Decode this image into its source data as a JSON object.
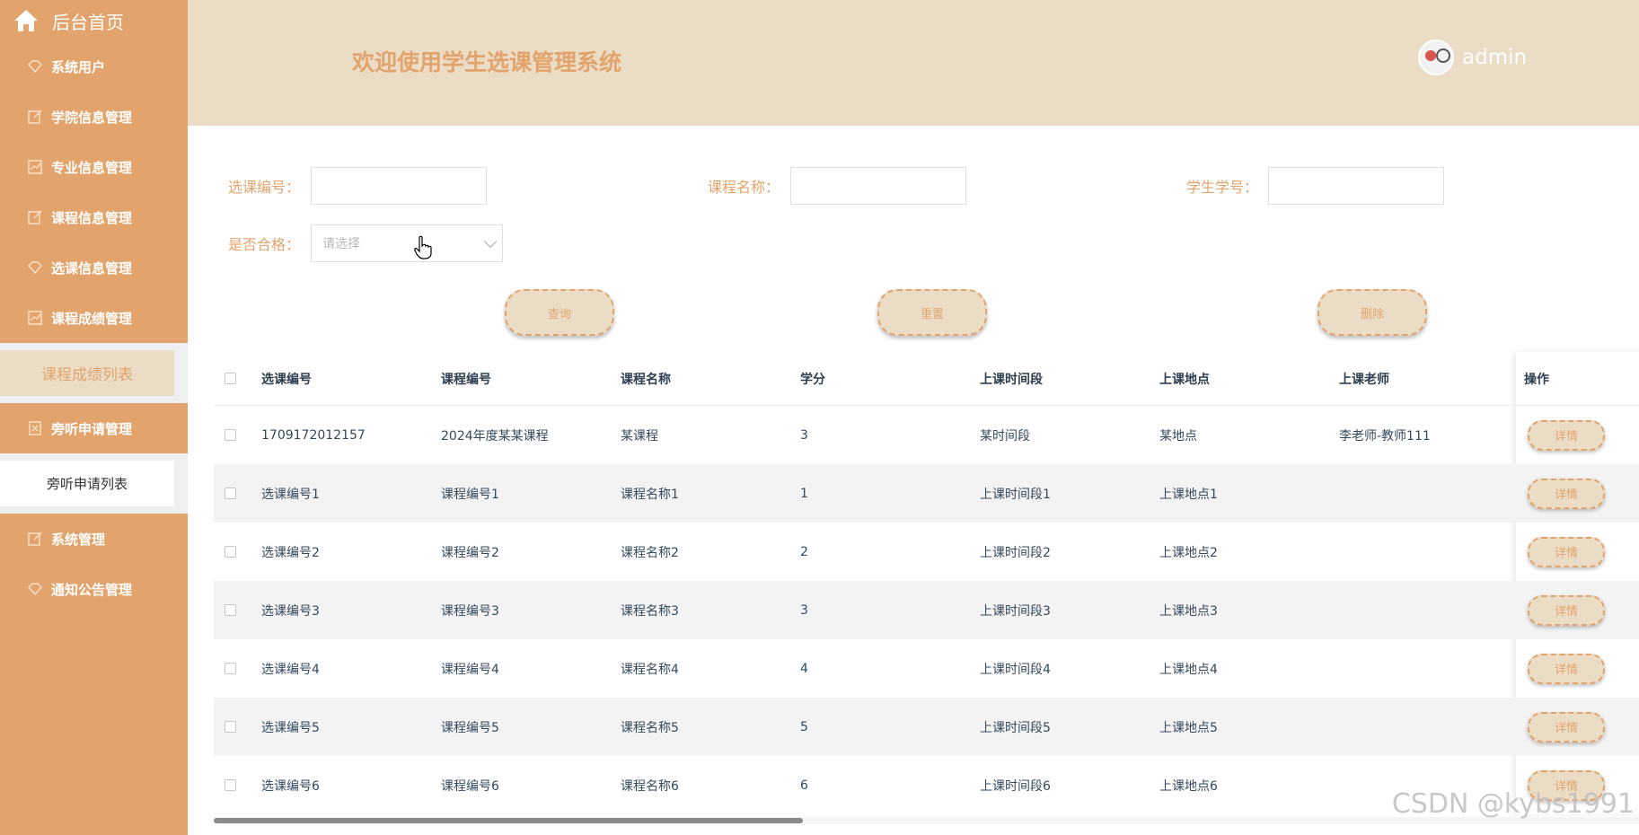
{
  "sidebar": {
    "home_label": "后台首页",
    "items": [
      {
        "label": "系统用户",
        "icon": "gem-icon"
      },
      {
        "label": "学院信息管理",
        "icon": "edit-icon"
      },
      {
        "label": "专业信息管理",
        "icon": "chart-icon"
      },
      {
        "label": "课程信息管理",
        "icon": "edit-icon"
      },
      {
        "label": "选课信息管理",
        "icon": "gem-icon"
      },
      {
        "label": "课程成绩管理",
        "icon": "chart-icon"
      }
    ],
    "active_sub": "课程成绩列表",
    "audit_menu": "旁听申请管理",
    "audit_sub": "旁听申请列表",
    "system_menu": "系统管理",
    "notice_menu": "通知公告管理"
  },
  "header": {
    "title": "欢迎使用学生选课管理系统",
    "username": "admin"
  },
  "search": {
    "selection_no_label": "选课编号：",
    "course_name_label": "课程名称：",
    "student_no_label": "学生学号：",
    "qualified_label": "是否合格：",
    "qualified_placeholder": "请选择",
    "query_button": "查询",
    "reset_button": "重置",
    "delete_button": "删除"
  },
  "table": {
    "columns": [
      "选课编号",
      "课程编号",
      "课程名称",
      "学分",
      "上课时间段",
      "上课地点",
      "上课老师",
      "操作"
    ],
    "detail_label": "详情",
    "rows": [
      [
        "1709172012157",
        "2024年度某某课程",
        "某课程",
        "3",
        "某时间段",
        "某地点",
        "李老师-教师111"
      ],
      [
        "选课编号1",
        "课程编号1",
        "课程名称1",
        "1",
        "上课时间段1",
        "上课地点1",
        ""
      ],
      [
        "选课编号2",
        "课程编号2",
        "课程名称2",
        "2",
        "上课时间段2",
        "上课地点2",
        ""
      ],
      [
        "选课编号3",
        "课程编号3",
        "课程名称3",
        "3",
        "上课时间段3",
        "上课地点3",
        ""
      ],
      [
        "选课编号4",
        "课程编号4",
        "课程名称4",
        "4",
        "上课时间段4",
        "上课地点4",
        ""
      ],
      [
        "选课编号5",
        "课程编号5",
        "课程名称5",
        "5",
        "上课时间段5",
        "上课地点5",
        ""
      ],
      [
        "选课编号6",
        "课程编号6",
        "课程名称6",
        "6",
        "上课时间段6",
        "上课地点6",
        ""
      ]
    ]
  },
  "watermark": "CSDN @kybs1991",
  "colors": {
    "accent": "#E2A46C",
    "header_bg": "#EBDCC6"
  }
}
